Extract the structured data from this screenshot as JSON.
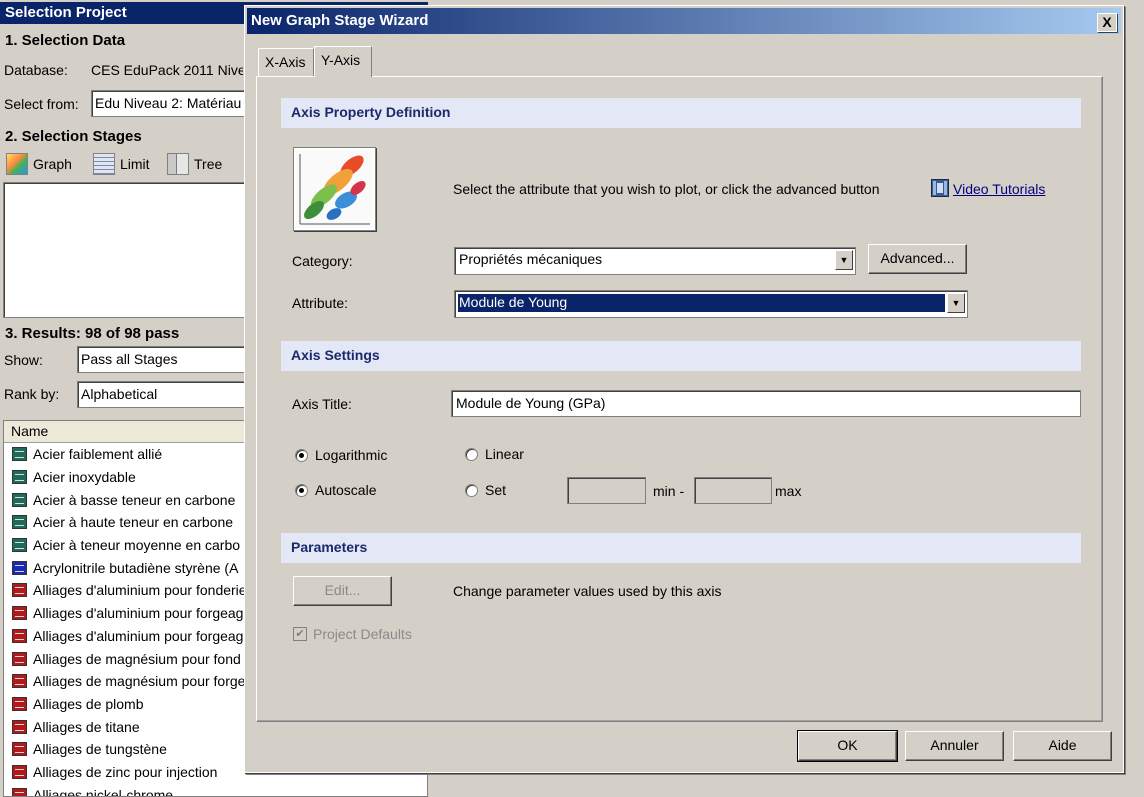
{
  "left": {
    "title": "Selection Project",
    "section1": "1. Selection Data",
    "database_label": "Database:",
    "database_value": "CES EduPack 2011 Nive",
    "select_from_label": "Select from:",
    "select_from_value": "Edu Niveau 2: Matériau",
    "section2": "2. Selection Stages",
    "stage_buttons": {
      "graph": "Graph",
      "limit": "Limit",
      "tree": "Tree"
    },
    "section3": "3. Results: 98 of 98 pass",
    "show_label": "Show:",
    "show_value": "Pass all Stages",
    "rank_label": "Rank by:",
    "rank_value": "Alphabetical",
    "column_name": "Name",
    "results": [
      {
        "name": "Acier faiblement allié",
        "color": "#1e6b5c"
      },
      {
        "name": "Acier inoxydable",
        "color": "#1e6b5c"
      },
      {
        "name": "Acier à basse teneur en carbone",
        "color": "#1e6b5c"
      },
      {
        "name": "Acier à haute teneur en carbone",
        "color": "#1e6b5c"
      },
      {
        "name": "Acier à teneur moyenne en carbo",
        "color": "#1e6b5c"
      },
      {
        "name": "Acrylonitrile butadiène styrène (A",
        "color": "#1a2ab0"
      },
      {
        "name": "Alliages d'aluminium pour fonderie",
        "color": "#b01a1a"
      },
      {
        "name": "Alliages d'aluminium pour forgeag",
        "color": "#b01a1a"
      },
      {
        "name": "Alliages d'aluminium pour forgeag",
        "color": "#b01a1a"
      },
      {
        "name": "Alliages de magnésium pour fond",
        "color": "#b01a1a"
      },
      {
        "name": "Alliages de magnésium pour forge",
        "color": "#b01a1a"
      },
      {
        "name": "Alliages de plomb",
        "color": "#b01a1a"
      },
      {
        "name": "Alliages de titane",
        "color": "#b01a1a"
      },
      {
        "name": "Alliages de tungstène",
        "color": "#b01a1a"
      },
      {
        "name": "Alliages de zinc pour injection",
        "color": "#b01a1a"
      },
      {
        "name": "Alliages nickel-chrome",
        "color": "#b01a1a"
      }
    ]
  },
  "dialog": {
    "title": "New Graph Stage Wizard",
    "close": "X",
    "tabs": [
      "X-Axis",
      "Y-Axis"
    ],
    "active_tab": "Y-Axis",
    "axis_property_header": "Axis Property Definition",
    "instruction": "Select the attribute that you wish to plot, or click the advanced button",
    "video_tutorials": "Video Tutorials",
    "category_label": "Category:",
    "category_value": "Propriétés mécaniques",
    "advanced_button": "Advanced...",
    "attribute_label": "Attribute:",
    "attribute_value": "Module de Young",
    "axis_settings_header": "Axis Settings",
    "axis_title_label": "Axis Title:",
    "axis_title_value": "Module de Young (GPa)",
    "scale_options": {
      "logarithmic": "Logarithmic",
      "linear": "Linear",
      "selected": "Logarithmic"
    },
    "range_options": {
      "autoscale": "Autoscale",
      "set": "Set",
      "selected": "Autoscale"
    },
    "min_label": "min -",
    "max_label": "max",
    "min_value": "",
    "max_value": "",
    "parameters_header": "Parameters",
    "edit_button": "Edit...",
    "parameters_text": "Change parameter values used by this axis",
    "project_defaults": "Project Defaults",
    "project_defaults_checked": true,
    "ok_button": "OK",
    "cancel_button": "Annuler",
    "help_button": "Aide"
  }
}
